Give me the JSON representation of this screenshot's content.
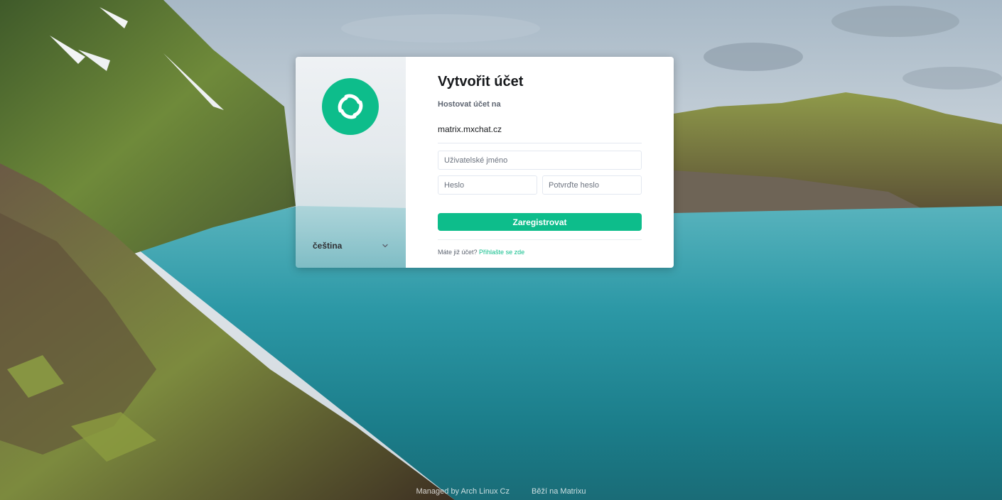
{
  "app": {
    "brand_color": "#0dbd8b",
    "logo_icon": "element-logo-icon"
  },
  "sidebar": {
    "language": "čeština",
    "language_chevron": "chevron-down-icon"
  },
  "form": {
    "title": "Vytvořit účet",
    "host_label": "Hostovat účet na",
    "host_value": "matrix.mxchat.cz",
    "username_placeholder": "Uživatelské jméno",
    "username_value": "",
    "password_placeholder": "Heslo",
    "password_value": "",
    "confirm_placeholder": "Potvrďte heslo",
    "confirm_value": "",
    "register_label": "Zaregistrovat",
    "have_account": "Máte již účet?",
    "login_link": "Přihlašte se zde"
  },
  "footer": {
    "managed_by": "Managed by Arch Linux Cz",
    "powered_by": "Běží na Matrixu"
  }
}
